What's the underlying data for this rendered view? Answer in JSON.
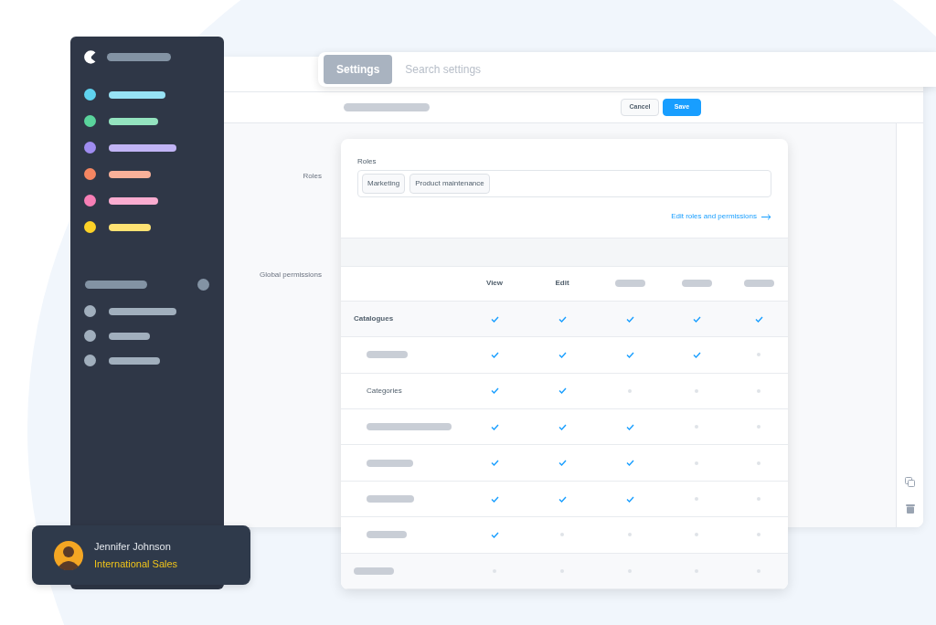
{
  "sidebar": {
    "items": [
      {
        "color": "#5fd3ef"
      },
      {
        "color": "#5ad49c"
      },
      {
        "color": "#9f8cf0"
      },
      {
        "color": "#f58662"
      },
      {
        "color": "#f77fb6"
      },
      {
        "color": "#fdd227"
      }
    ]
  },
  "search": {
    "tab": "Settings",
    "placeholder": "Search settings"
  },
  "toolbar": {
    "buttons": [
      {
        "label": "Cancel",
        "kind": "secondary"
      },
      {
        "label": "Save",
        "kind": "primary"
      }
    ]
  },
  "form": {
    "labels": [
      "Roles",
      "Global permissions"
    ]
  },
  "roles": {
    "label": "Roles",
    "tags": [
      "Marketing",
      "Product maintenance"
    ],
    "link": "Edit roles and permissions"
  },
  "permissions": {
    "columns": [
      {
        "kind": "text",
        "label": "View"
      },
      {
        "kind": "text",
        "label": "Edit"
      },
      {
        "kind": "placeholder"
      },
      {
        "kind": "placeholder"
      },
      {
        "kind": "placeholder"
      }
    ],
    "rows": [
      {
        "kind": "text",
        "label": "Catalogues",
        "checks": [
          true,
          true,
          true,
          true,
          true
        ],
        "children": [
          {
            "kind": "placeholder",
            "checks": [
              true,
              true,
              true,
              true,
              false
            ]
          },
          {
            "kind": "text",
            "label": "Categories",
            "checks": [
              true,
              true,
              false,
              false,
              false
            ]
          },
          {
            "kind": "placeholder",
            "checks": [
              true,
              true,
              true,
              false,
              false
            ]
          },
          {
            "kind": "placeholder",
            "checks": [
              true,
              true,
              true,
              false,
              false
            ]
          },
          {
            "kind": "placeholder",
            "checks": [
              true,
              true,
              true,
              false,
              false
            ]
          },
          {
            "kind": "placeholder",
            "checks": [
              true,
              false,
              false,
              false,
              false
            ]
          }
        ]
      },
      {
        "kind": "placeholder",
        "checks": [
          false,
          false,
          false,
          false,
          false
        ]
      }
    ]
  },
  "user": {
    "name": "Jennifer Johnson",
    "role": "International Sales"
  }
}
